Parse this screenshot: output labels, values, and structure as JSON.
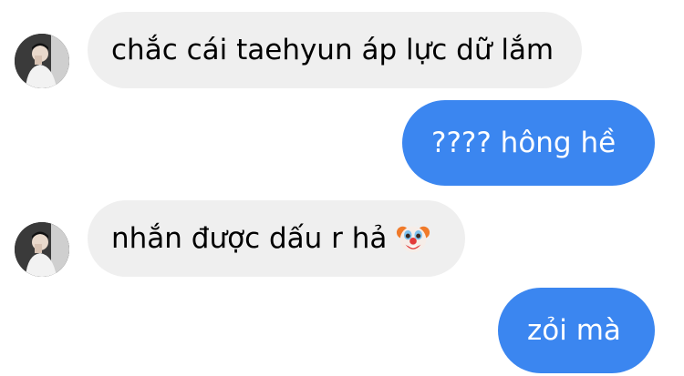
{
  "conversation": {
    "messages": [
      {
        "direction": "incoming",
        "text": "chắc cái taehyun áp lực dữ lắm",
        "has_avatar": true
      },
      {
        "direction": "outgoing",
        "text": "???? hông hề"
      },
      {
        "direction": "incoming",
        "text": "nhắn được dấu r hả",
        "emoji": "clown-face-icon",
        "has_avatar": true
      },
      {
        "direction": "outgoing",
        "text": "zỏi mà"
      }
    ]
  },
  "colors": {
    "incoming_bubble": "#efefef",
    "outgoing_bubble": "#3b86f0",
    "incoming_text": "#000000",
    "outgoing_text": "#ffffff"
  }
}
